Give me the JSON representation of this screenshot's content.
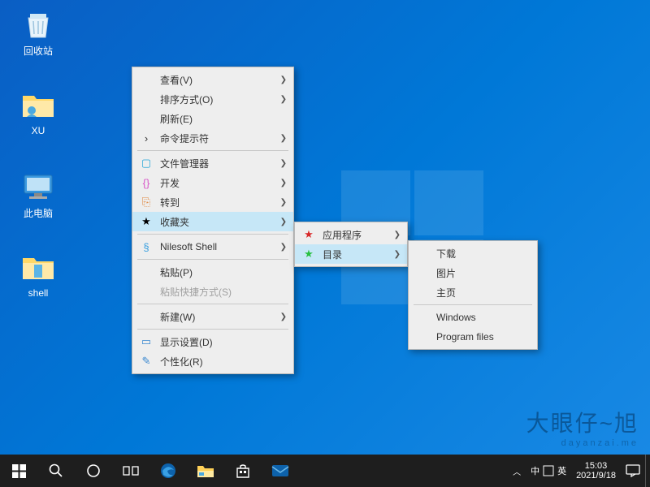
{
  "desktop_icons": {
    "recycle_bin": "回收站",
    "user_folder": "XU",
    "this_pc": "此电脑",
    "shell_folder": "shell"
  },
  "context1": {
    "view": "查看(V)",
    "sort": "排序方式(O)",
    "refresh": "刷新(E)",
    "cmd": "命令提示符",
    "file_mgr": "文件管理器",
    "dev": "开发",
    "goto": "转到",
    "favorites": "收藏夹",
    "nilesoft": "Nilesoft Shell",
    "paste": "粘贴(P)",
    "paste_shortcut": "粘贴快捷方式(S)",
    "new": "新建(W)",
    "display_settings": "显示设置(D)",
    "personalize": "个性化(R)"
  },
  "context2": {
    "apps": "应用程序",
    "dirs": "目录"
  },
  "context3": {
    "downloads": "下载",
    "pictures": "图片",
    "home": "主页",
    "windows": "Windows",
    "program_files": "Program files"
  },
  "taskbar": {
    "time": "15:03",
    "date": "2021/9/18",
    "ime_chinese": "中",
    "ime_eng": "英"
  },
  "watermark": {
    "big": "大眼仔~旭",
    "small": "dayanzai.me"
  }
}
